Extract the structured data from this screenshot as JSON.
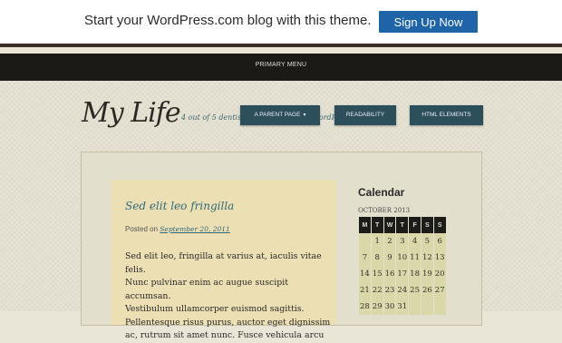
{
  "promo": {
    "text": "Start your WordPress.com blog with this theme.",
    "signup_label": "Sign Up Now"
  },
  "menubar": {
    "label": "PRIMARY MENU"
  },
  "site": {
    "title": "My Life",
    "tagline": "4 out of 5 dentists recommend this WordPress.com site"
  },
  "nav": {
    "items": [
      {
        "label": "A PARENT PAGE",
        "has_dropdown": true
      },
      {
        "label": "READABILITY"
      },
      {
        "label": "HTML ELEMENTS"
      }
    ]
  },
  "post": {
    "title": "Sed elit leo fringilla",
    "meta_prefix": "Posted on",
    "date": "September 20, 2011",
    "body_lines": [
      "Sed elit leo, fringilla at varius at, iaculis vitae felis.",
      "Nunc pulvinar enim ac augue suscipit accumsan.",
      "Vestibulum ullamcorper euismod sagittis.",
      "Pellentesque risus purus, auctor eget dignissim",
      "ac, rutrum sit amet nunc. Fusce vehicula arcu"
    ]
  },
  "calendar": {
    "heading": "Calendar",
    "caption": "OCTOBER 2013",
    "weekdays": [
      "M",
      "T",
      "W",
      "T",
      "F",
      "S",
      "S"
    ],
    "weeks": [
      [
        "",
        "1",
        "2",
        "3",
        "4",
        "5",
        "6"
      ],
      [
        "7",
        "8",
        "9",
        "10",
        "11",
        "12",
        "13"
      ],
      [
        "14",
        "15",
        "16",
        "17",
        "18",
        "19",
        "20"
      ],
      [
        "21",
        "22",
        "23",
        "24",
        "25",
        "26",
        "27"
      ],
      [
        "28",
        "29",
        "30",
        "31",
        "",
        "",
        ""
      ]
    ]
  }
}
